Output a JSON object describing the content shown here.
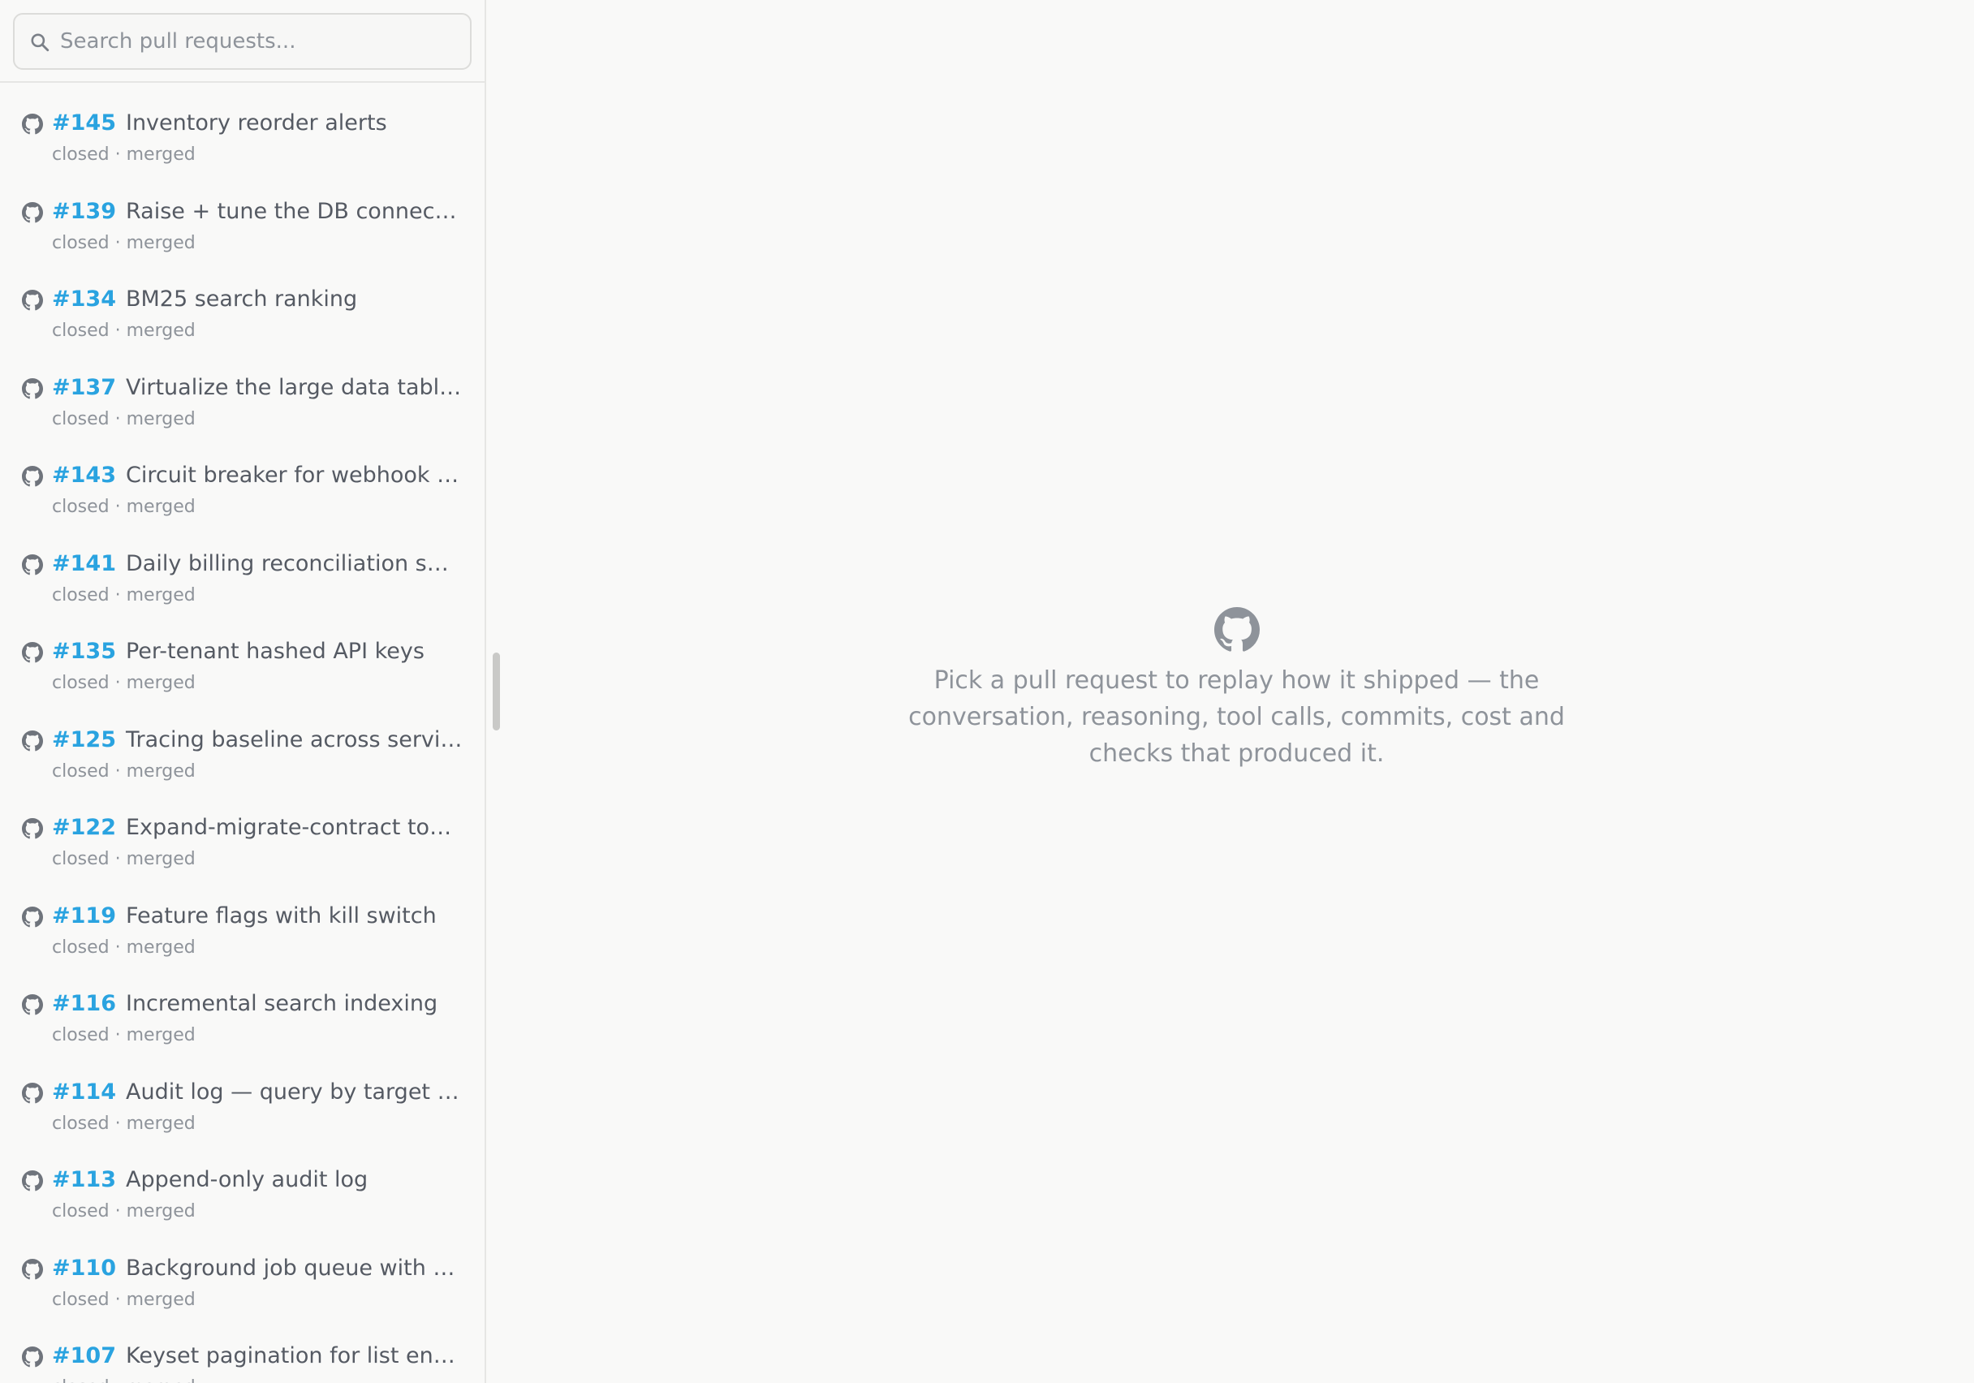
{
  "search": {
    "placeholder": "Search pull requests..."
  },
  "pull_requests": [
    {
      "number": "#145",
      "title": "Inventory reorder alerts",
      "status": "closed · merged"
    },
    {
      "number": "#139",
      "title": "Raise + tune the DB connectio...",
      "status": "closed · merged"
    },
    {
      "number": "#134",
      "title": "BM25 search ranking",
      "status": "closed · merged"
    },
    {
      "number": "#137",
      "title": "Virtualize the large data tables",
      "status": "closed · merged"
    },
    {
      "number": "#143",
      "title": "Circuit breaker for webhook d...",
      "status": "closed · merged"
    },
    {
      "number": "#141",
      "title": "Daily billing reconciliation sweep",
      "status": "closed · merged"
    },
    {
      "number": "#135",
      "title": "Per-tenant hashed API keys",
      "status": "closed · merged"
    },
    {
      "number": "#125",
      "title": "Tracing baseline across servic...",
      "status": "closed · merged"
    },
    {
      "number": "#122",
      "title": "Expand-migrate-contract tooli...",
      "status": "closed · merged"
    },
    {
      "number": "#119",
      "title": "Feature flags with kill switch",
      "status": "closed · merged"
    },
    {
      "number": "#116",
      "title": "Incremental search indexing",
      "status": "closed · merged"
    },
    {
      "number": "#114",
      "title": "Audit log — query by target r...",
      "status": "closed · merged"
    },
    {
      "number": "#113",
      "title": "Append-only audit log",
      "status": "closed · merged"
    },
    {
      "number": "#110",
      "title": "Background job queue with vi...",
      "status": "closed · merged"
    },
    {
      "number": "#107",
      "title": "Keyset pagination for list endp...",
      "status": "closed · merged"
    }
  ],
  "empty_state": {
    "icon": "github-icon",
    "message": "Pick a pull request to replay how it shipped — the conversation, reasoning, tool calls, commits, cost and checks that produced it."
  },
  "colors": {
    "accent": "#2aa3e0",
    "text": "#555a63",
    "muted": "#8e939a",
    "background": "#f9f9f8"
  }
}
